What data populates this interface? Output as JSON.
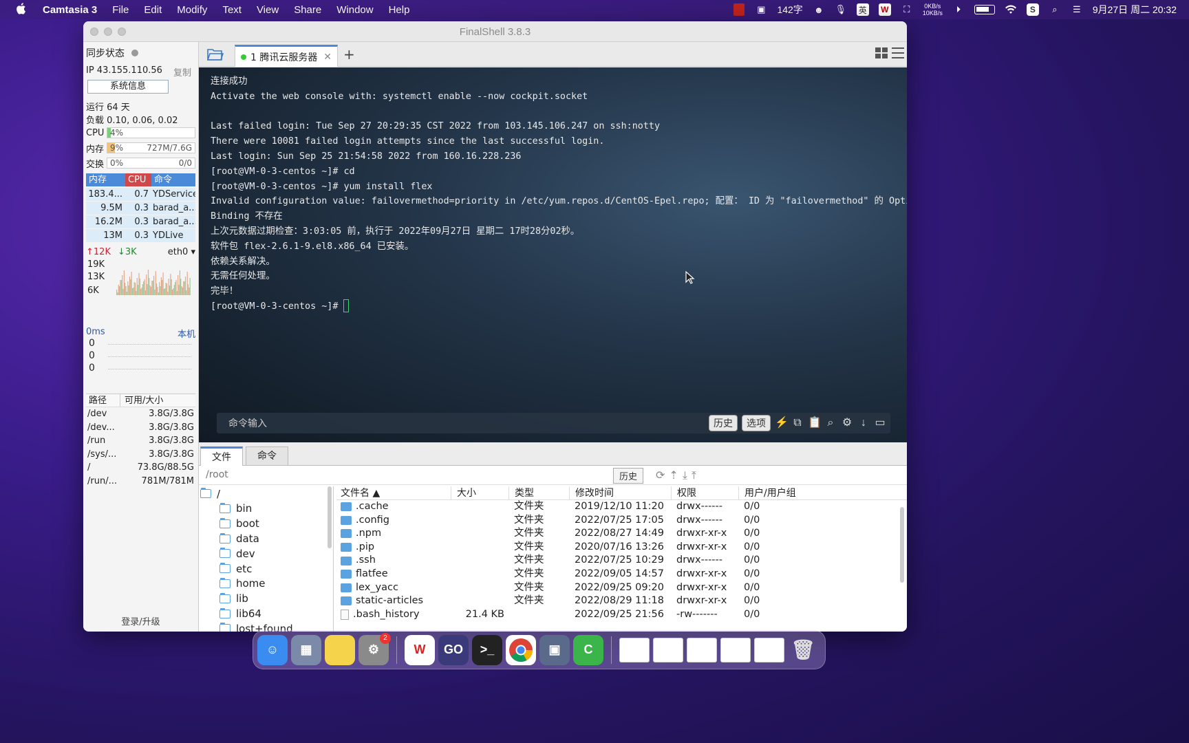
{
  "menubar": {
    "app_name": "Camtasia 3",
    "menus": [
      "File",
      "Edit",
      "Modify",
      "Text",
      "View",
      "Share",
      "Window",
      "Help"
    ],
    "word_count": "142字",
    "ime": "英",
    "net_up": "0KB/s",
    "net_down": "10KB/s",
    "datetime": "9月27日 周二  20:32"
  },
  "window": {
    "title": "FinalShell 3.8.3"
  },
  "left_panel": {
    "sync_label": "同步状态",
    "ip_label": "IP 43.155.110.56",
    "copy_label": "复制",
    "sysinfo_button": "系统信息",
    "uptime": "运行 64 天",
    "load": "负载 0.10, 0.06, 0.02",
    "cpu": {
      "label": "CPU",
      "pct": "4%",
      "fraction": 0.04
    },
    "mem": {
      "label": "内存",
      "pct": "9%",
      "detail": "727M/7.6G",
      "fraction": 0.09
    },
    "swap": {
      "label": "交换",
      "pct": "0%",
      "detail": "0/0"
    },
    "proc_headers": {
      "mem": "内存",
      "cpu": "CPU",
      "cmd": "命令"
    },
    "processes": [
      {
        "mem": "183.4...",
        "cpu": "0.7",
        "cmd": "YDService"
      },
      {
        "mem": "9.5M",
        "cpu": "0.3",
        "cmd": "barad_a..."
      },
      {
        "mem": "16.2M",
        "cpu": "0.3",
        "cmd": "barad_a..."
      },
      {
        "mem": "13M",
        "cpu": "0.3",
        "cmd": "YDLive"
      }
    ],
    "net": {
      "up": "12K",
      "down": "3K",
      "iface": "eth0",
      "y_labels": [
        "19K",
        "13K",
        "6K"
      ]
    },
    "ping": {
      "latency": "0ms",
      "host": "本机",
      "values": [
        "0",
        "0",
        "0"
      ]
    },
    "disk_headers": {
      "path": "路径",
      "size": "可用/大小"
    },
    "disks": [
      {
        "path": "/dev",
        "size": "3.8G/3.8G"
      },
      {
        "path": "/dev...",
        "size": "3.8G/3.8G"
      },
      {
        "path": "/run",
        "size": "3.8G/3.8G"
      },
      {
        "path": "/sys/...",
        "size": "3.8G/3.8G"
      },
      {
        "path": "/",
        "size": "73.8G/88.5G"
      },
      {
        "path": "/run/...",
        "size": "781M/781M"
      }
    ],
    "login_label": "登录/升级"
  },
  "tabs": [
    {
      "label": "1 腾讯云服务器"
    }
  ],
  "terminal": {
    "lines": [
      "连接成功",
      "Activate the web console with: systemctl enable --now cockpit.socket",
      "",
      "Last failed login: Tue Sep 27 20:29:35 CST 2022 from 103.145.106.247 on ssh:notty",
      "There were 10081 failed login attempts since the last successful login.",
      "Last login: Sun Sep 25 21:54:58 2022 from 160.16.228.236",
      "[root@VM-0-3-centos ~]# cd",
      "[root@VM-0-3-centos ~]# yum install flex",
      "Invalid configuration value: failovermethod=priority in /etc/yum.repos.d/CentOS-Epel.repo; 配置： ID 为 \"failovermethod\" 的 Option",
      "Binding 不存在",
      "上次元数据过期检查：3:03:05 前，执行于 2022年09月27日 星期二 17时28分02秒。",
      "软件包 flex-2.6.1-9.el8.x86_64 已安装。",
      "依赖关系解决。",
      "无需任何处理。",
      "完毕！"
    ],
    "prompt": "[root@VM-0-3-centos ~]# ",
    "cmd_placeholder": "命令输入",
    "history_button": "历史",
    "options_button": "选项"
  },
  "file_manager": {
    "tabs": [
      "文件",
      "命令"
    ],
    "path": "/root",
    "history_button": "历史",
    "tree_root": "/",
    "tree": [
      "bin",
      "boot",
      "data",
      "dev",
      "etc",
      "home",
      "lib",
      "lib64",
      "lost+found"
    ],
    "columns": {
      "name": "文件名 ▲",
      "size": "大小",
      "type": "类型",
      "time": "修改时间",
      "perm": "权限",
      "owner": "用户/用户组"
    },
    "files": [
      {
        "name": ".cache",
        "size": "",
        "type": "文件夹",
        "time": "2019/12/10 11:20",
        "perm": "drwx------",
        "owner": "0/0",
        "dir": true
      },
      {
        "name": ".config",
        "size": "",
        "type": "文件夹",
        "time": "2022/07/25 17:05",
        "perm": "drwx------",
        "owner": "0/0",
        "dir": true
      },
      {
        "name": ".npm",
        "size": "",
        "type": "文件夹",
        "time": "2022/08/27 14:49",
        "perm": "drwxr-xr-x",
        "owner": "0/0",
        "dir": true
      },
      {
        "name": ".pip",
        "size": "",
        "type": "文件夹",
        "time": "2020/07/16 13:26",
        "perm": "drwxr-xr-x",
        "owner": "0/0",
        "dir": true
      },
      {
        "name": ".ssh",
        "size": "",
        "type": "文件夹",
        "time": "2022/07/25 10:29",
        "perm": "drwx------",
        "owner": "0/0",
        "dir": true
      },
      {
        "name": "flatfee",
        "size": "",
        "type": "文件夹",
        "time": "2022/09/05 14:57",
        "perm": "drwxr-xr-x",
        "owner": "0/0",
        "dir": true
      },
      {
        "name": "lex_yacc",
        "size": "",
        "type": "文件夹",
        "time": "2022/09/25 09:20",
        "perm": "drwxr-xr-x",
        "owner": "0/0",
        "dir": true
      },
      {
        "name": "static-articles",
        "size": "",
        "type": "文件夹",
        "time": "2022/08/29 11:18",
        "perm": "drwxr-xr-x",
        "owner": "0/0",
        "dir": true
      },
      {
        "name": ".bash_history",
        "size": "21.4 KB",
        "type": "",
        "time": "2022/09/25 21:56",
        "perm": "-rw-------",
        "owner": "0/0",
        "dir": false
      }
    ]
  },
  "dock": {
    "apps": [
      {
        "name": "finder",
        "color": "#3b8cf0"
      },
      {
        "name": "launchpad",
        "color": "#7a8aa8"
      },
      {
        "name": "notes",
        "color": "#f5d34a"
      },
      {
        "name": "system-preferences",
        "color": "#8a8a8a",
        "badge": "2"
      },
      {
        "name": "wps",
        "color": "#ffffff"
      },
      {
        "name": "goland",
        "color": "#3a3a7a"
      },
      {
        "name": "terminal",
        "color": "#222222"
      },
      {
        "name": "chrome",
        "color": "#ffffff"
      },
      {
        "name": "remote-desktop",
        "color": "#5a6a8a"
      },
      {
        "name": "camtasia",
        "color": "#3bb54a"
      }
    ],
    "go_label": "GO",
    "terminal_label": ">_"
  }
}
